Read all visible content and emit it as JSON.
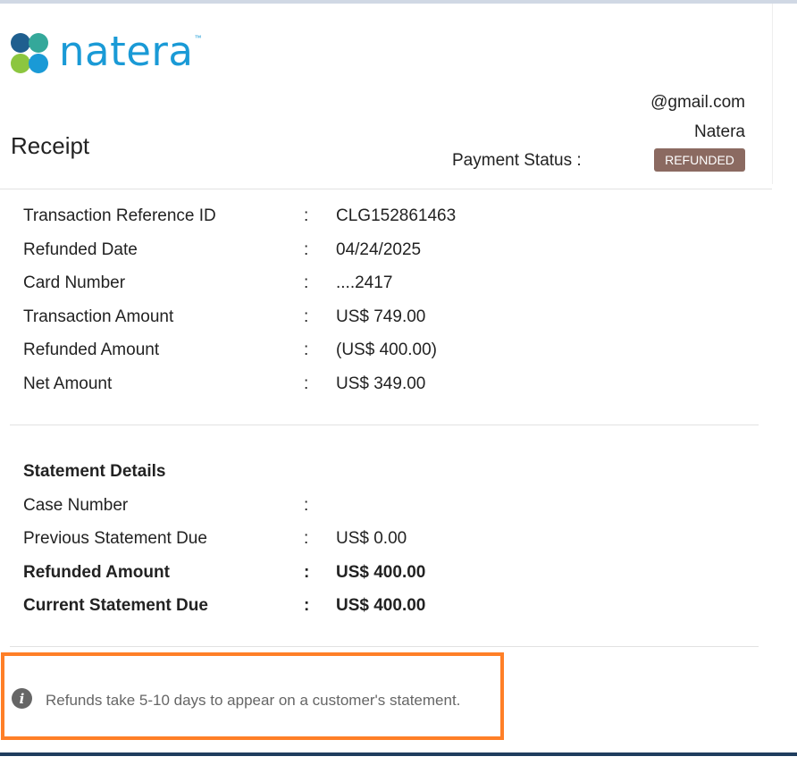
{
  "brand": {
    "name": "natera",
    "trademark": "™",
    "colors": {
      "blue": "#1a9ad6",
      "green": "#8cc63f",
      "dark_blue": "#1f5f8f",
      "teal": "#34a89a"
    }
  },
  "header": {
    "title": "Receipt",
    "email": "@gmail.com",
    "organization": "Natera",
    "payment_status_label": "Payment Status :",
    "payment_status_value": "REFUNDED",
    "status_badge_color": "#8b6a61"
  },
  "transaction": {
    "rows": [
      {
        "label": "Transaction Reference ID",
        "separator": ":",
        "value": "CLG152861463"
      },
      {
        "label": "Refunded Date",
        "separator": ":",
        "value": "04/24/2025"
      },
      {
        "label": "Card Number",
        "separator": ":",
        "value": "....2417"
      },
      {
        "label": "Transaction Amount",
        "separator": ":",
        "value": "US$ 749.00"
      },
      {
        "label": "Refunded Amount",
        "separator": ":",
        "value": "(US$ 400.00)"
      },
      {
        "label": "Net Amount",
        "separator": ":",
        "value": "US$ 349.00"
      }
    ]
  },
  "statement": {
    "title": "Statement Details",
    "rows": [
      {
        "label": "Case Number",
        "separator": ":",
        "value": ""
      },
      {
        "label": "Previous Statement Due",
        "separator": ":",
        "value": "US$ 0.00"
      },
      {
        "label": "Refunded Amount",
        "separator": ":",
        "value": "US$ 400.00"
      },
      {
        "label": "Current Statement Due",
        "separator": ":",
        "value": "US$ 400.00"
      }
    ]
  },
  "notice": {
    "icon": "info-icon",
    "glyph": "i",
    "text": "Refunds take 5-10 days to appear on a customer's statement.",
    "highlight_color": "#ff7f27"
  }
}
